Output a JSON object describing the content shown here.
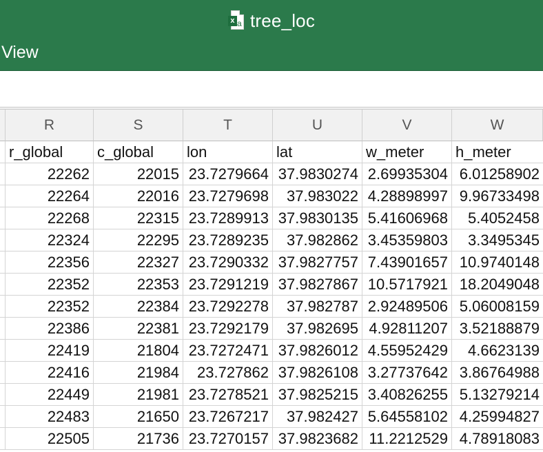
{
  "window": {
    "title": "tree_loc",
    "icon": "excel-document-icon",
    "icon_badge": "x",
    "icon_letter": "a",
    "menu_view_label": "View"
  },
  "colors": {
    "titlebar": "#2b7a4b",
    "header_bg": "#f1f1f1",
    "gridline": "#d4d4d4"
  },
  "columns": [
    "R",
    "S",
    "T",
    "U",
    "V",
    "W"
  ],
  "field_headers": [
    "r_global",
    "c_global",
    "lon",
    "lat",
    "w_meter",
    "h_meter"
  ],
  "rows": [
    [
      "22262",
      "22015",
      "23.7279664",
      "37.9830274",
      "2.69935304",
      "6.01258902"
    ],
    [
      "22264",
      "22016",
      "23.7279698",
      "37.983022",
      "4.28898997",
      "9.96733498"
    ],
    [
      "22268",
      "22315",
      "23.7289913",
      "37.9830135",
      "5.41606968",
      "5.4052458"
    ],
    [
      "22324",
      "22295",
      "23.7289235",
      "37.982862",
      "3.45359803",
      "3.3495345"
    ],
    [
      "22356",
      "22327",
      "23.7290332",
      "37.9827757",
      "7.43901657",
      "10.9740148"
    ],
    [
      "22352",
      "22353",
      "23.7291219",
      "37.9827867",
      "10.5717921",
      "18.2049048"
    ],
    [
      "22352",
      "22384",
      "23.7292278",
      "37.982787",
      "2.92489506",
      "5.06008159"
    ],
    [
      "22386",
      "22381",
      "23.7292179",
      "37.982695",
      "4.92811207",
      "3.52188879"
    ],
    [
      "22419",
      "21804",
      "23.7272471",
      "37.9826012",
      "4.55952429",
      "4.6623139"
    ],
    [
      "22416",
      "21984",
      "23.727862",
      "37.9826108",
      "3.27737642",
      "3.86764988"
    ],
    [
      "22449",
      "21981",
      "23.7278521",
      "37.9825215",
      "3.40826255",
      "5.13279214"
    ],
    [
      "22483",
      "21650",
      "23.7267217",
      "37.982427",
      "5.64558102",
      "4.25994827"
    ],
    [
      "22505",
      "21736",
      "23.7270157",
      "37.9823682",
      "11.2212529",
      "4.78918083"
    ]
  ]
}
